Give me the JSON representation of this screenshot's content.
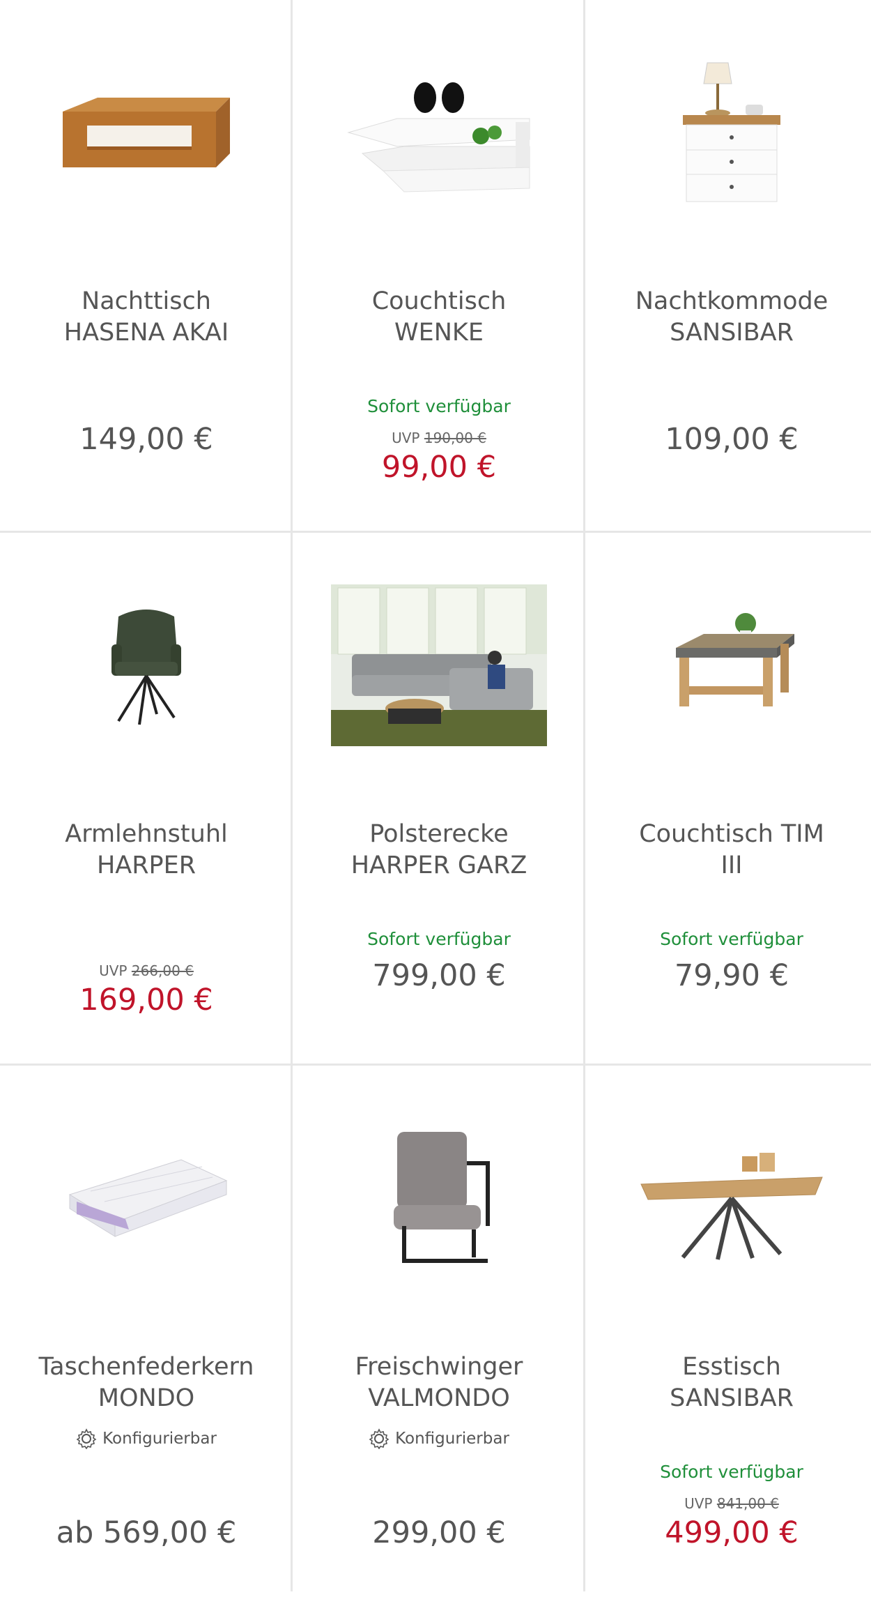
{
  "products": [
    {
      "name1": "Nachttisch",
      "name2": "HASENA AKAI",
      "price": "149,00 €"
    },
    {
      "name1": "Couchtisch",
      "name2": "WENKE",
      "availability": "Sofort verfügbar",
      "uvp_label": "UVP",
      "uvp_price": "190,00 €",
      "price": "99,00 €"
    },
    {
      "name1": "Nachtkommode",
      "name2": "SANSIBAR",
      "price": "109,00 €"
    },
    {
      "name1": "Armlehnstuhl",
      "name2": "HARPER",
      "uvp_label": "UVP",
      "uvp_price": "266,00 €",
      "price": "169,00 €"
    },
    {
      "name1": "Polsterecke",
      "name2": "HARPER GARZ",
      "availability": "Sofort verfügbar",
      "price": "799,00 €"
    },
    {
      "name1": "Couchtisch TIM",
      "name2": "III",
      "availability": "Sofort verfügbar",
      "price": "79,90 €"
    },
    {
      "name1": "Taschenfederkern",
      "name2": "MONDO",
      "config": "Konfigurierbar",
      "price": "ab 569,00 €"
    },
    {
      "name1": "Freischwinger",
      "name2": "VALMONDO",
      "config": "Konfigurierbar",
      "price": "299,00 €"
    },
    {
      "name1": "Esstisch",
      "name2": "SANSIBAR",
      "availability": "Sofort verfügbar",
      "uvp_label": "UVP",
      "uvp_price": "841,00 €",
      "price": "499,00 €"
    }
  ],
  "colors": {
    "available": "#1f8f3a",
    "sale_price": "#c0142a",
    "text": "#555555",
    "divider": "#e6e6e6"
  }
}
